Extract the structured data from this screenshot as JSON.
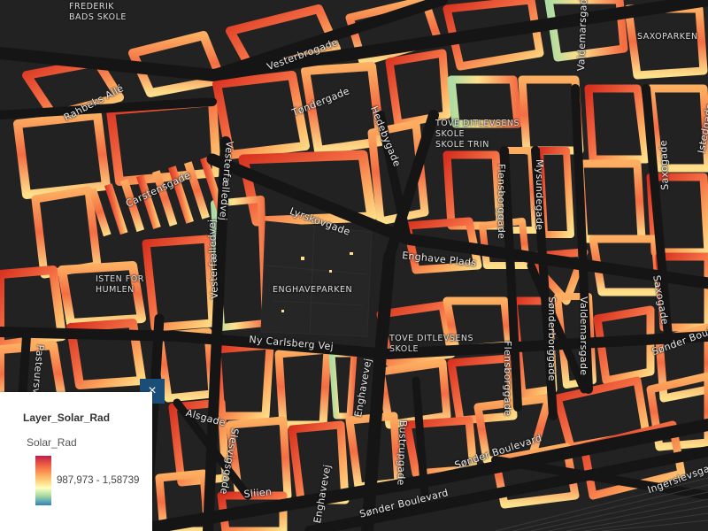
{
  "map": {
    "streets": [
      {
        "name": "Vesterbrogade",
        "key": "vesterbrogade"
      },
      {
        "name": "Rahbeks Allé",
        "key": "rahbeks-alle"
      },
      {
        "name": "Tøndergade",
        "key": "tondergade"
      },
      {
        "name": "Hedebygade",
        "key": "hedebygade"
      },
      {
        "name": "Vesterfælledvej",
        "key": "vesterfaelledvej"
      },
      {
        "name": "Carstensgade",
        "key": "carstensgade"
      },
      {
        "name": "Lyrskovgade",
        "key": "lyrskovgade"
      },
      {
        "name": "Enghave Plads",
        "key": "enghave-plads"
      },
      {
        "name": "Flensborggade",
        "key": "flensborggade-n"
      },
      {
        "name": "Mysundegade",
        "key": "mysundegade"
      },
      {
        "name": "Valdemarsgade",
        "key": "valdemarsgade-n"
      },
      {
        "name": "Saxogade",
        "key": "saxogade-n"
      },
      {
        "name": "Istedgade",
        "key": "istedgade"
      },
      {
        "name": "Pasteursvej",
        "key": "pasteursvej"
      },
      {
        "name": "Vesterfælledvej",
        "key": "vesterfaelledvej-s"
      },
      {
        "name": "Ny Carlsberg Vej",
        "key": "ny-carlsberg-vej"
      },
      {
        "name": "Enghavevej",
        "key": "enghavevej"
      },
      {
        "name": "Flensborggade",
        "key": "flensborggade-s"
      },
      {
        "name": "Sønderborggade",
        "key": "sonderborggade"
      },
      {
        "name": "Valdemarsgade",
        "key": "valdemarsgade-s"
      },
      {
        "name": "Saxogade",
        "key": "saxogade-s"
      },
      {
        "name": "Sønder Boulevard",
        "key": "sonder-boulevard-e"
      },
      {
        "name": "Alsgade",
        "key": "alsgade"
      },
      {
        "name": "Slesvigsgade",
        "key": "slesvigsgade"
      },
      {
        "name": "Sliien",
        "key": "sliien"
      },
      {
        "name": "Enghavevej",
        "key": "enghavevej-s"
      },
      {
        "name": "Bustrupgade",
        "key": "bustrupgade"
      },
      {
        "name": "Sønder Boulevard",
        "key": "sonder-boulevard-s"
      },
      {
        "name": "Sønder Boulevard",
        "key": "sonder-boulevard-c"
      },
      {
        "name": "Ingerslevsgade",
        "key": "ingerslevsgade"
      }
    ],
    "places": [
      {
        "name": "FREDERIK\nBADS SKOLE",
        "key": "frederik-skole"
      },
      {
        "name": "SAXOPARKEN",
        "key": "saxoparken"
      },
      {
        "name": "TOVE DITLEVSENS\nSKOLE\nSKOLE TRIN",
        "key": "tove-skole-n"
      },
      {
        "name": "ENGHAVEPARKEN",
        "key": "enghaveparken"
      },
      {
        "name": "ISTEN FOR\nHUMLEN",
        "key": "isten-for-humlen"
      },
      {
        "name": "TOVE DITLEVSENS\nSKOLE",
        "key": "tove-skole-s"
      }
    ]
  },
  "legend": {
    "layer_title": "Layer_Solar_Rad",
    "field_name": "Solar_Rad",
    "range_label": "987,973 - 1,58739",
    "ramp_colors": [
      "#c51b4a",
      "#f46d43",
      "#fdae61",
      "#fee08b",
      "#ffffbf",
      "#abdda4",
      "#2b83ba"
    ],
    "close_symbol": "×"
  }
}
